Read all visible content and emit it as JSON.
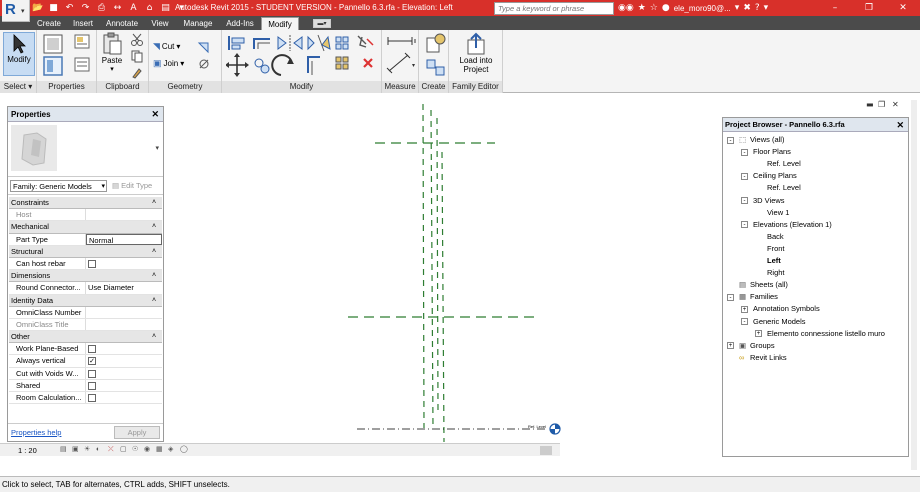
{
  "titlebar": {
    "app_logo": "R",
    "title": "Autodesk Revit 2015 - STUDENT VERSION -     Pannello 6.3.rfa - Elevation: Left",
    "search_placeholder": "Type a keyword or phrase",
    "user": "ele_moro90@...",
    "accent": "#d8302a"
  },
  "tabs": [
    "Create",
    "Insert",
    "Annotate",
    "View",
    "Manage",
    "Add-Ins",
    "Modify"
  ],
  "active_tab": "Modify",
  "ribbon": {
    "select": {
      "modify_label": "Modify",
      "panel_label": "Select ▾"
    },
    "properties": {
      "panel_label": "Properties"
    },
    "clipboard": {
      "paste_label": "Paste",
      "panel_label": "Clipboard"
    },
    "geometry": {
      "cut_label": "Cut",
      "join_label": "Join",
      "panel_label": "Geometry"
    },
    "modify": {
      "panel_label": "Modify"
    },
    "measure": {
      "panel_label": "Measure"
    },
    "create": {
      "panel_label": "Create"
    },
    "family_editor": {
      "load_line1": "Load into",
      "load_line2": "Project",
      "panel_label": "Family Editor"
    }
  },
  "properties": {
    "title": "Properties",
    "family_selector": "Family: Generic Models",
    "edit_type": "Edit Type",
    "rows": [
      {
        "kind": "cat",
        "name": "Constraints"
      },
      {
        "kind": "prop",
        "name": "Host",
        "value": "",
        "dim": true
      },
      {
        "kind": "cat",
        "name": "Mechanical"
      },
      {
        "kind": "prop",
        "name": "Part Type",
        "value": "Normal",
        "boxed": true
      },
      {
        "kind": "cat",
        "name": "Structural"
      },
      {
        "kind": "check",
        "name": "Can host rebar",
        "checked": false
      },
      {
        "kind": "cat",
        "name": "Dimensions"
      },
      {
        "kind": "prop",
        "name": "Round Connector...",
        "value": "Use Diameter"
      },
      {
        "kind": "cat",
        "name": "Identity Data"
      },
      {
        "kind": "prop",
        "name": "OmniClass Number",
        "value": ""
      },
      {
        "kind": "prop",
        "name": "OmniClass Title",
        "value": "",
        "dim": true
      },
      {
        "kind": "cat",
        "name": "Other"
      },
      {
        "kind": "check",
        "name": "Work Plane-Based",
        "checked": false
      },
      {
        "kind": "check",
        "name": "Always vertical",
        "checked": true
      },
      {
        "kind": "check",
        "name": "Cut with Voids W...",
        "checked": false
      },
      {
        "kind": "check",
        "name": "Shared",
        "checked": false
      },
      {
        "kind": "check",
        "name": "Room Calculation...",
        "checked": false
      }
    ],
    "help_link": "Properties help",
    "apply_label": "Apply"
  },
  "project_browser": {
    "title": "Project Browser - Pannello 6.3.rfa",
    "nodes": [
      {
        "label": "Views (all)",
        "level": 0,
        "exp": "-",
        "icon": "views"
      },
      {
        "label": "Floor Plans",
        "level": 1,
        "exp": "-"
      },
      {
        "label": "Ref. Level",
        "level": 2
      },
      {
        "label": "Ceiling Plans",
        "level": 1,
        "exp": "-"
      },
      {
        "label": "Ref. Level",
        "level": 2
      },
      {
        "label": "3D Views",
        "level": 1,
        "exp": "-"
      },
      {
        "label": "View 1",
        "level": 2
      },
      {
        "label": "Elevations (Elevation 1)",
        "level": 1,
        "exp": "-"
      },
      {
        "label": "Back",
        "level": 2
      },
      {
        "label": "Front",
        "level": 2
      },
      {
        "label": "Left",
        "level": 2,
        "bold": true
      },
      {
        "label": "Right",
        "level": 2
      },
      {
        "label": "Sheets (all)",
        "level": 0,
        "icon": "sheets"
      },
      {
        "label": "Families",
        "level": 0,
        "exp": "-",
        "icon": "families"
      },
      {
        "label": "Annotation Symbols",
        "level": 1,
        "exp": "+"
      },
      {
        "label": "Generic Models",
        "level": 1,
        "exp": "-"
      },
      {
        "label": "Elemento connessione listello muro",
        "level": 2,
        "exp": "+"
      },
      {
        "label": "Groups",
        "level": 0,
        "exp": "+",
        "icon": "groups"
      },
      {
        "label": "Revit Links",
        "level": 0,
        "icon": "links"
      }
    ]
  },
  "view_bar": {
    "scale": "1 : 20"
  },
  "level_label": "Ref. Level",
  "status_text": "Click to select, TAB for alternates, CTRL adds, SHIFT unselects.",
  "colors": {
    "reference_plane": "#2e7d32",
    "level_marker": "#1f5ba8",
    "ribbon": "#f4f4f4",
    "tab_bar": "#4b4b4b"
  }
}
